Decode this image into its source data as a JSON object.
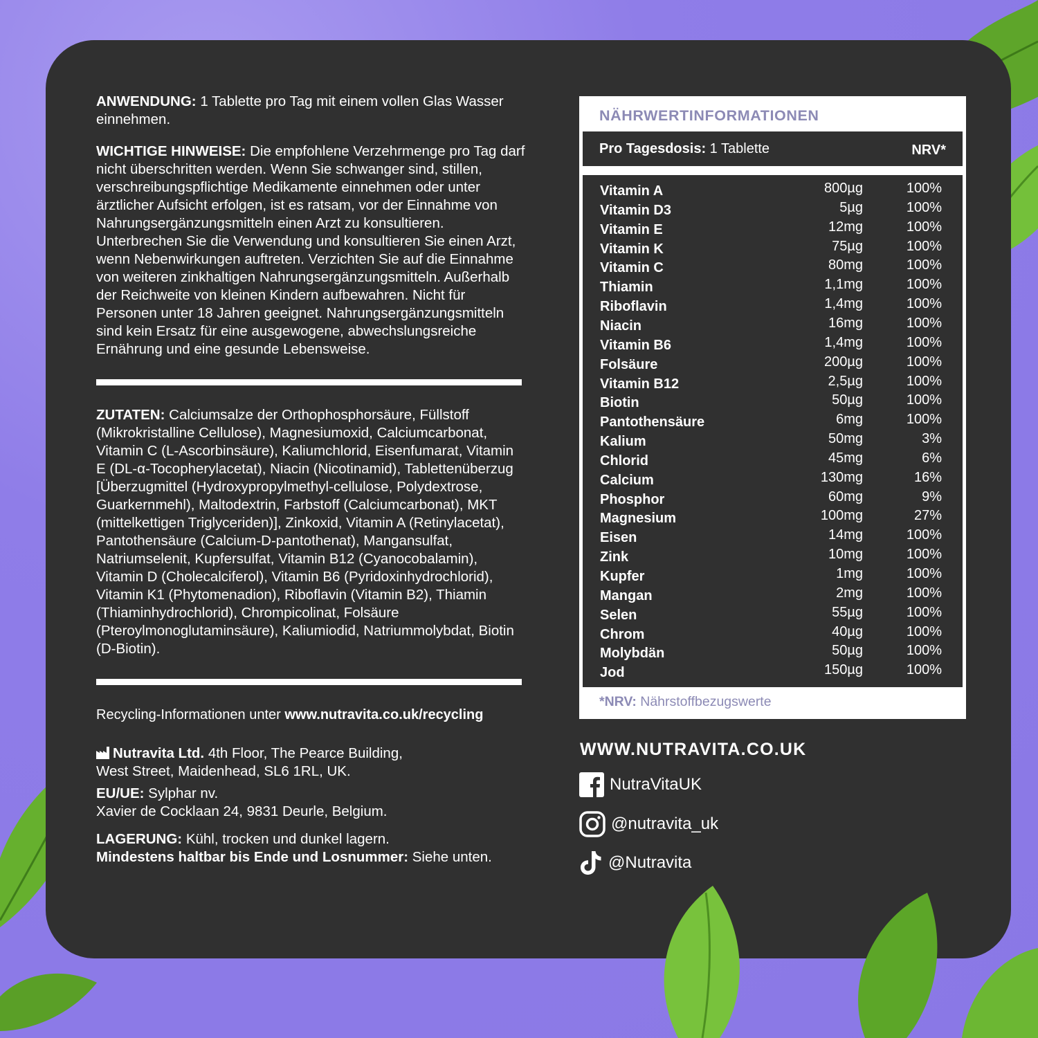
{
  "usage": {
    "label": "ANWENDUNG:",
    "text": " 1 Tablette pro Tag mit einem vollen Glas Wasser einnehmen."
  },
  "warnings": {
    "label": "WICHTIGE HINWEISE:",
    "text": " Die empfohlene Verzehrmenge pro Tag darf nicht überschritten werden. Wenn Sie schwanger sind, stillen, verschreibungspflichtige Medikamente einnehmen oder unter ärztlicher Aufsicht erfolgen, ist es ratsam, vor der Einnahme von Nahrungsergänzungsmitteln einen Arzt zu konsultieren. Unterbrechen Sie die Verwendung und konsultieren Sie einen Arzt, wenn Nebenwirkungen auftreten. Verzichten Sie auf die Einnahme von weiteren zinkhaltigen Nahrungsergänzungsmitteln.  Außerhalb der Reichweite von kleinen Kindern aufbewahren. Nicht für Personen unter 18 Jahren geeignet. Nahrungsergänzungsmitteln sind kein Ersatz für eine ausgewogene, abwechslungsreiche Ernährung und eine gesunde Lebensweise."
  },
  "ingredients": {
    "label": "ZUTATEN:",
    "text": " Calciumsalze der Orthophosphorsäure, Füllstoff (Mikrokristalline Cellulose), Magnesiumoxid, Calciumcarbonat, Vitamin C (L-Ascorbinsäure), Kaliumchlorid, Eisenfumarat, Vitamin E (DL-α-Tocopherylacetat), Niacin (Nicotinamid), Tablettenüberzug [Überzugmittel (Hydroxypropylmethyl-cellulose, Polydextrose, Guarkernmehl), Maltodextrin, Farbstoff (Calciumcarbonat), MKT (mittelkettigen Triglyceriden)], Zinkoxid, Vitamin A (Retinylacetat), Pantothensäure (Calcium-D-pantothenat), Mangansulfat, Natriumselenit, Kupfersulfat, Vitamin B12 (Cyanocobalamin), Vitamin D (Cholecalciferol), Vitamin B6 (Pyridoxinhydrochlorid), Vitamin K1 (Phytomenadion), Riboflavin (Vitamin B2), Thiamin (Thiaminhydrochlorid), Chrompicolinat, Folsäure (Pteroylmonoglutaminsäure), Kaliumiodid, Natriummolybdat, Biotin (D-Biotin)."
  },
  "recycling": {
    "text": "Recycling-Informationen unter ",
    "url": "www.nutravita.co.uk/recycling"
  },
  "company": {
    "name": "Nutravita Ltd.",
    "line1": " 4th Floor, The Pearce Building,",
    "line2": "West Street, Maidenhead, SL6 1RL, UK."
  },
  "eu": {
    "label": "EU/UE:",
    "line1": " Sylphar nv.",
    "line2": "Xavier de Cocklaan 24, 9831 Deurle, Belgium."
  },
  "storage": {
    "label": "LAGERUNG:",
    "text": " Kühl, trocken und dunkel lagern."
  },
  "bestbefore": {
    "label": "Mindestens haltbar bis Ende und Losnummer:",
    "text": " Siehe unten."
  },
  "nutrition": {
    "title": "NÄHRWERTINFORMATIONEN",
    "dose_label": "Pro Tagesdosis:",
    "dose_value": " 1 Tablette",
    "nrv_header": "NRV*",
    "rows": [
      {
        "name": "Vitamin A",
        "amount": "800µg",
        "nrv": "100%"
      },
      {
        "name": "Vitamin D3",
        "amount": "5µg",
        "nrv": "100%"
      },
      {
        "name": "Vitamin E",
        "amount": "12mg",
        "nrv": "100%"
      },
      {
        "name": "Vitamin K",
        "amount": "75µg",
        "nrv": "100%"
      },
      {
        "name": "Vitamin C",
        "amount": "80mg",
        "nrv": "100%"
      },
      {
        "name": "Thiamin",
        "amount": "1,1mg",
        "nrv": "100%"
      },
      {
        "name": "Riboflavin",
        "amount": "1,4mg",
        "nrv": "100%"
      },
      {
        "name": "Niacin",
        "amount": "16mg",
        "nrv": "100%"
      },
      {
        "name": "Vitamin B6",
        "amount": "1,4mg",
        "nrv": "100%"
      },
      {
        "name": "Folsäure",
        "amount": "200µg",
        "nrv": "100%"
      },
      {
        "name": "Vitamin B12",
        "amount": "2,5µg",
        "nrv": "100%"
      },
      {
        "name": "Biotin",
        "amount": "50µg",
        "nrv": "100%"
      },
      {
        "name": "Pantothensäure",
        "amount": "6mg",
        "nrv": "100%"
      },
      {
        "name": "Kalium",
        "amount": "50mg",
        "nrv": "3%"
      },
      {
        "name": "Chlorid",
        "amount": "45mg",
        "nrv": "6%"
      },
      {
        "name": "Calcium",
        "amount": "130mg",
        "nrv": "16%"
      },
      {
        "name": "Phosphor",
        "amount": "60mg",
        "nrv": "9%"
      },
      {
        "name": "Magnesium",
        "amount": "100mg",
        "nrv": "27%"
      },
      {
        "name": "Eisen",
        "amount": "14mg",
        "nrv": "100%"
      },
      {
        "name": "Zink",
        "amount": "10mg",
        "nrv": "100%"
      },
      {
        "name": "Kupfer",
        "amount": "1mg",
        "nrv": "100%"
      },
      {
        "name": "Mangan",
        "amount": "2mg",
        "nrv": "100%"
      },
      {
        "name": "Selen",
        "amount": "55µg",
        "nrv": "100%"
      },
      {
        "name": "Chrom",
        "amount": "40µg",
        "nrv": "100%"
      },
      {
        "name": "Molybdän",
        "amount": "50µg",
        "nrv": "100%"
      },
      {
        "name": "Jod",
        "amount": "150µg",
        "nrv": "100%"
      }
    ],
    "footnote_label": "*NRV:",
    "footnote_text": " Nährstoffbezugswerte"
  },
  "website": "WWW.NUTRAVITA.CO.UK",
  "social": {
    "facebook": "NutraVitaUK",
    "instagram": "@nutravita_uk",
    "tiktok": "@Nutravita"
  },
  "colors": {
    "background": "#8f7de8",
    "panel": "#303030",
    "accent_text": "#8c8ab5",
    "leaf": "#6fb52c"
  }
}
